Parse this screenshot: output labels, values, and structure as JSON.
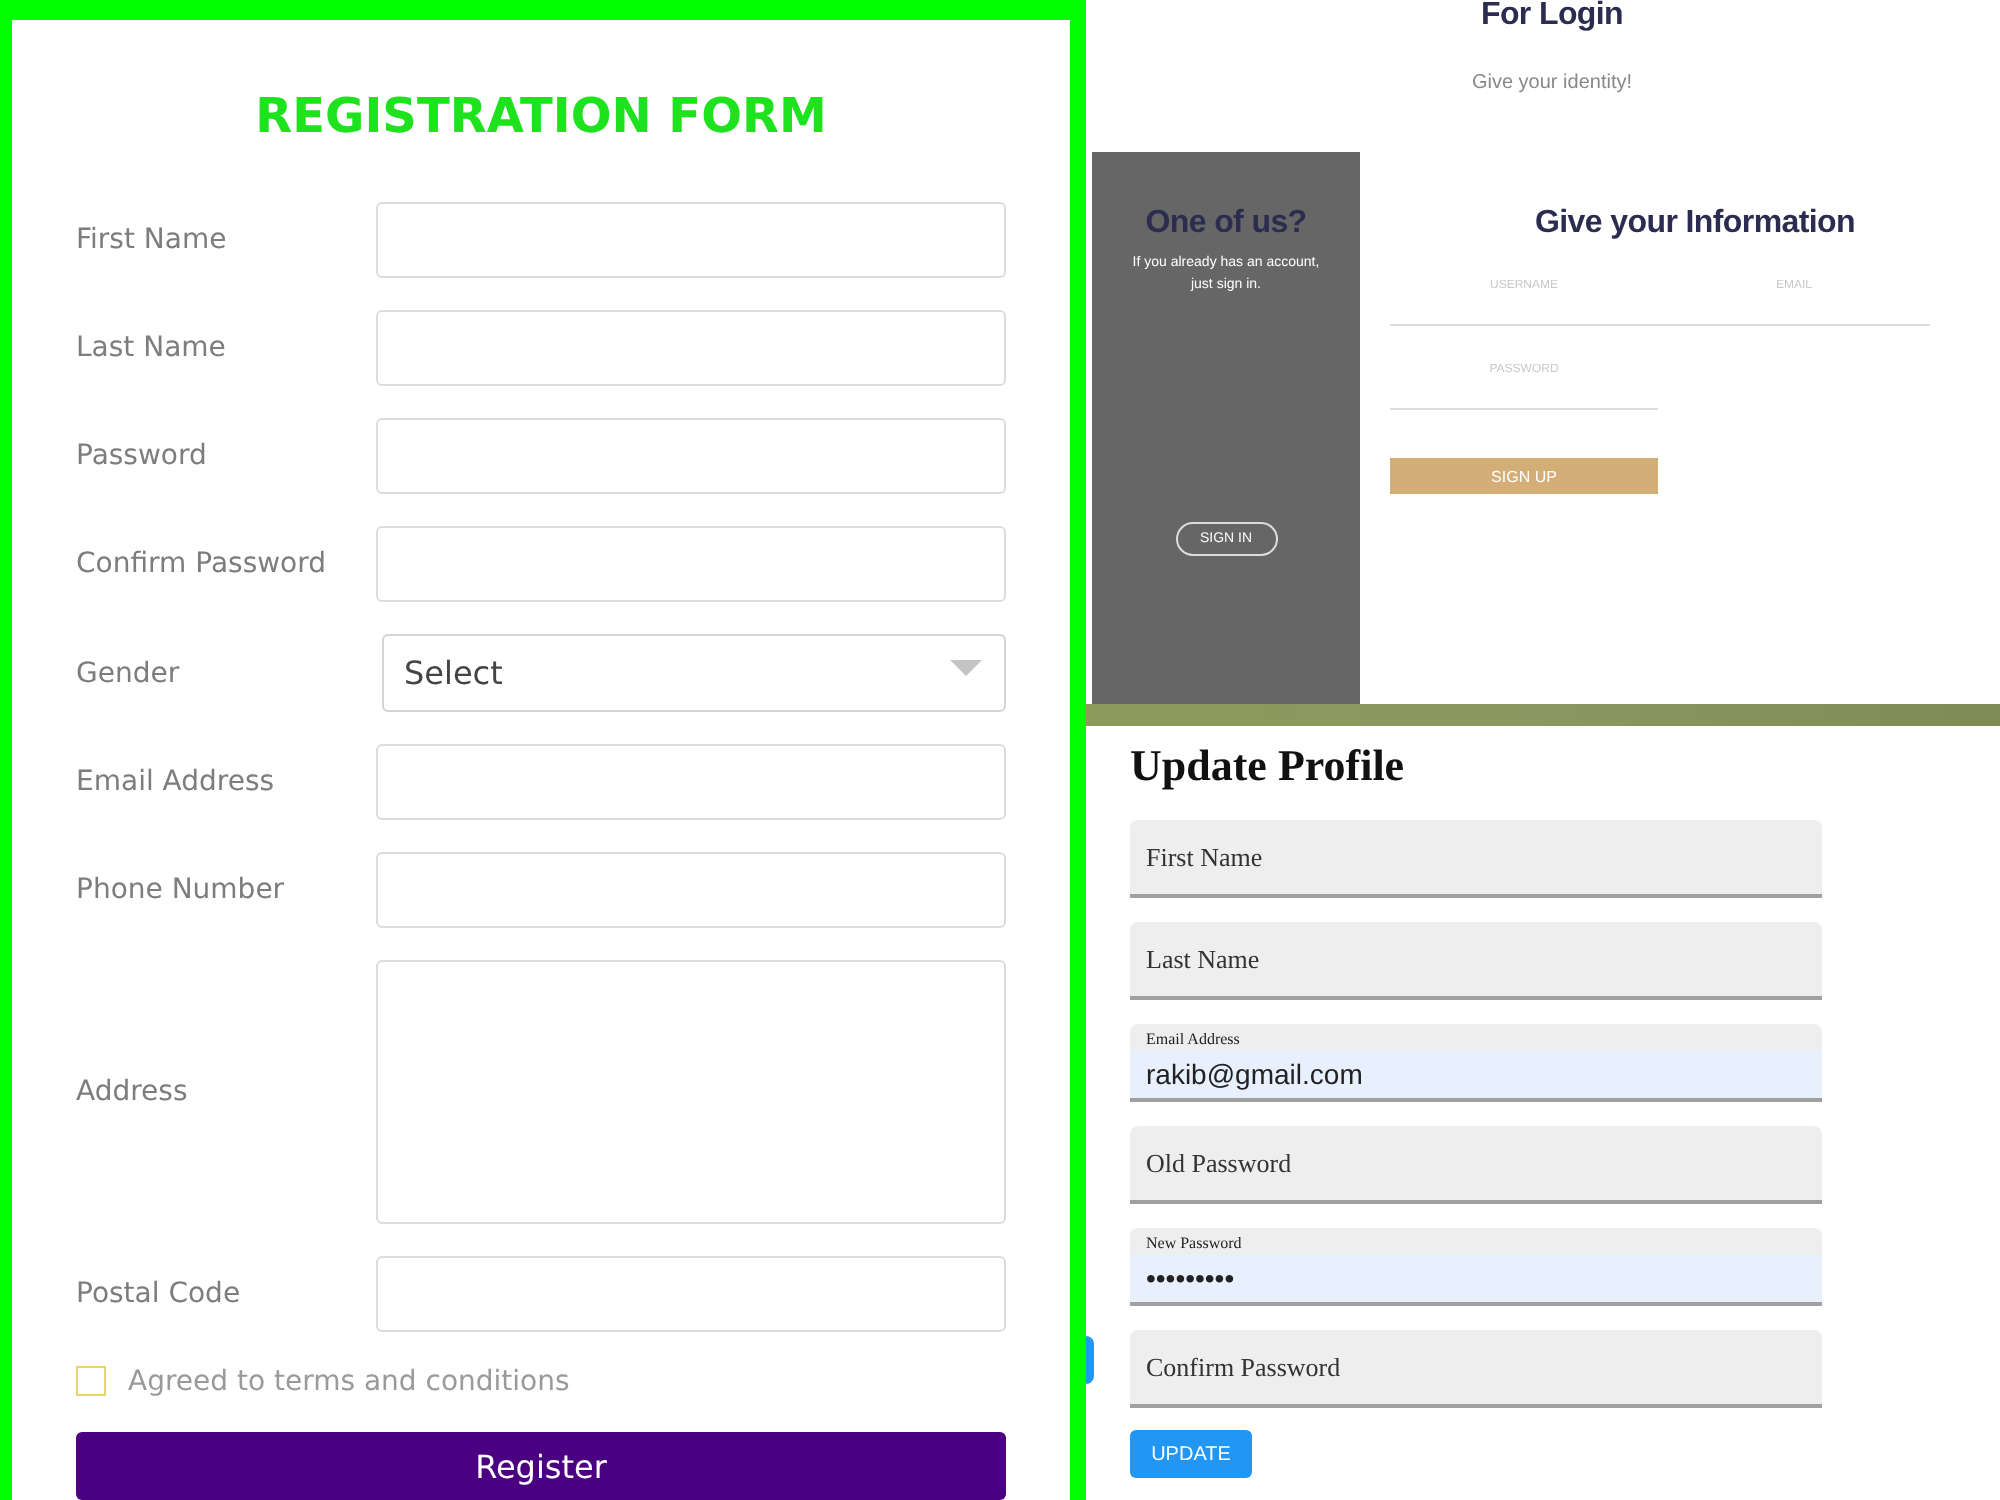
{
  "registration": {
    "title": "REGISTRATION FORM",
    "fields": [
      {
        "label": "First Name",
        "kind": "text"
      },
      {
        "label": "Last Name",
        "kind": "text"
      },
      {
        "label": "Password",
        "kind": "text"
      },
      {
        "label": "Confirm Password",
        "kind": "text"
      },
      {
        "label": "Gender",
        "kind": "select",
        "value": "Select"
      },
      {
        "label": "Email Address",
        "kind": "text"
      },
      {
        "label": "Phone Number",
        "kind": "text"
      },
      {
        "label": "Address",
        "kind": "textarea"
      },
      {
        "label": "Postal Code",
        "kind": "text"
      }
    ],
    "terms": {
      "label": "Agreed to terms and conditions",
      "checked": false
    },
    "button": "Register"
  },
  "login": {
    "title": "For Login",
    "subtitle": "Give your identity!",
    "side_panel": {
      "title": "One of us?",
      "text": "If you already has an account, just sign in.",
      "button": "SIGN IN"
    },
    "form": {
      "title": "Give your Information",
      "fields": [
        {
          "placeholder": "USERNAME"
        },
        {
          "placeholder": "EMAIL"
        },
        {
          "placeholder": "PASSWORD"
        }
      ],
      "button": "SIGN UP"
    }
  },
  "update_profile": {
    "title": "Update Profile",
    "fields": [
      {
        "kind": "empty",
        "placeholder": "First Name"
      },
      {
        "kind": "empty",
        "placeholder": "Last Name"
      },
      {
        "kind": "filled",
        "label": "Email Address",
        "value": "rakib@gmail.com"
      },
      {
        "kind": "empty",
        "placeholder": "Old Password"
      },
      {
        "kind": "filled",
        "label": "New Password",
        "value": "•••••••••"
      },
      {
        "kind": "empty",
        "placeholder": "Confirm Password"
      }
    ],
    "button": "UPDATE"
  }
}
